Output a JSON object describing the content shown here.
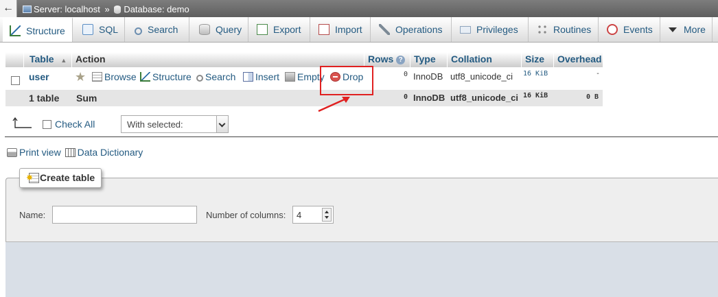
{
  "breadcrumb": {
    "back": "←",
    "server_label": "Server: localhost",
    "separator": "»",
    "database_label": "Database: demo"
  },
  "tabs": [
    {
      "label": "Structure",
      "icon": "structure-icon",
      "active": true
    },
    {
      "label": "SQL",
      "icon": "sql-icon"
    },
    {
      "label": "Search",
      "icon": "search-icon"
    },
    {
      "label": "Query",
      "icon": "query-icon"
    },
    {
      "label": "Export",
      "icon": "export-icon"
    },
    {
      "label": "Import",
      "icon": "import-icon"
    },
    {
      "label": "Operations",
      "icon": "wrench-icon"
    },
    {
      "label": "Privileges",
      "icon": "privileges-icon"
    },
    {
      "label": "Routines",
      "icon": "routines-icon"
    },
    {
      "label": "Events",
      "icon": "events-icon"
    },
    {
      "label": "More",
      "icon": "triangle-down-icon"
    }
  ],
  "table": {
    "headers": {
      "table": "Table",
      "sort_indicator": "▲",
      "action": "Action",
      "rows": "Rows",
      "rows_help": "?",
      "type": "Type",
      "collation": "Collation",
      "size": "Size",
      "overhead": "Overhead"
    },
    "rows": [
      {
        "name": "user",
        "actions": {
          "browse": "Browse",
          "structure": "Structure",
          "search": "Search",
          "insert": "Insert",
          "empty": "Empty",
          "drop": "Drop"
        },
        "rows": "0",
        "type": "InnoDB",
        "collation": "utf8_unicode_ci",
        "size": "16 KiB",
        "overhead": "-"
      }
    ],
    "summary": {
      "count": "1 table",
      "label": "Sum",
      "rows": "0",
      "type": "InnoDB",
      "collation": "utf8_unicode_ci",
      "size": "16 KiB",
      "overhead": "0 B"
    }
  },
  "bulk": {
    "check_all": "Check All",
    "with_selected": "With selected:"
  },
  "links": {
    "print_view": "Print view",
    "data_dictionary": "Data Dictionary"
  },
  "create_table": {
    "legend": "Create table",
    "name_label": "Name:",
    "name_value": "",
    "columns_label": "Number of columns:",
    "columns_value": "4"
  },
  "colors": {
    "link": "#235a81",
    "annotation": "#e02020"
  }
}
